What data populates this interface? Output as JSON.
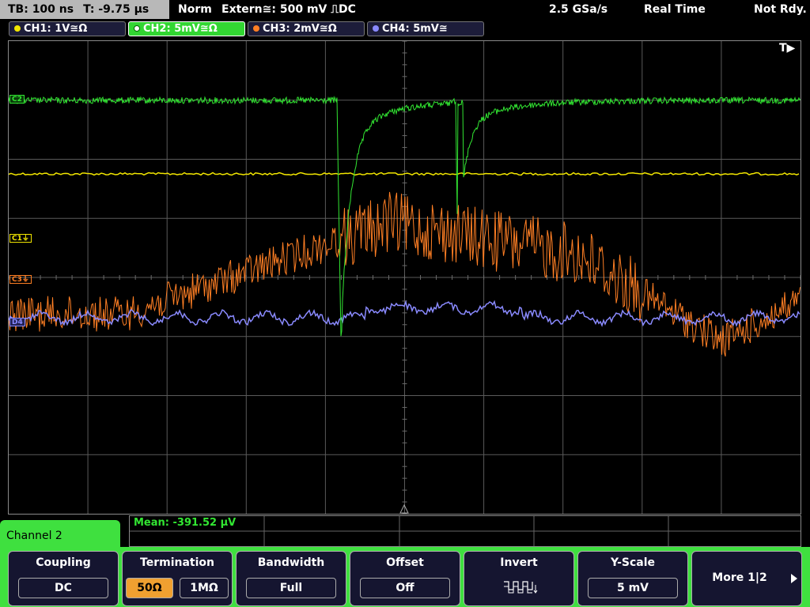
{
  "top_bar": {
    "timebase": "TB: 100 ns",
    "trigger_time": "T: -9.75 µs",
    "trigger_mode": "Norm",
    "trigger_source": "Extern≅: 500 mV ⎍DC",
    "sample_rate": "2.5 GSa/s",
    "acq_mode": "Real Time",
    "status": "Not Rdy."
  },
  "channels": [
    {
      "label": "CH1: 1V≅Ω",
      "color": "#f2e600"
    },
    {
      "label": "CH2: 5mV≅Ω",
      "color": "#32d632"
    },
    {
      "label": "CH3: 2mV≅Ω",
      "color": "#ff7f24"
    },
    {
      "label": "CH4: 5mV≅",
      "color": "#8a8aff"
    }
  ],
  "trace_markers": {
    "c2": "C2",
    "c1": "C1⏚",
    "c3": "C3⏚",
    "c4": "D4"
  },
  "trigger_indicator": "T▶",
  "measurement": {
    "text": "Mean: -391.52 µV"
  },
  "channel_panel": {
    "title": "Channel 2"
  },
  "softkeys": {
    "coupling": {
      "title": "Coupling",
      "value": "DC"
    },
    "termination": {
      "title": "Termination",
      "option1": "50Ω",
      "option2": "1MΩ"
    },
    "bandwidth": {
      "title": "Bandwidth",
      "value": "Full"
    },
    "offset": {
      "title": "Offset",
      "value": "Off"
    },
    "invert": {
      "title": "Invert",
      "icon": "invert-waveform-icon"
    },
    "yscale": {
      "title": "Y-Scale",
      "value": "5 mV"
    },
    "more": {
      "title": "More 1|2"
    }
  }
}
